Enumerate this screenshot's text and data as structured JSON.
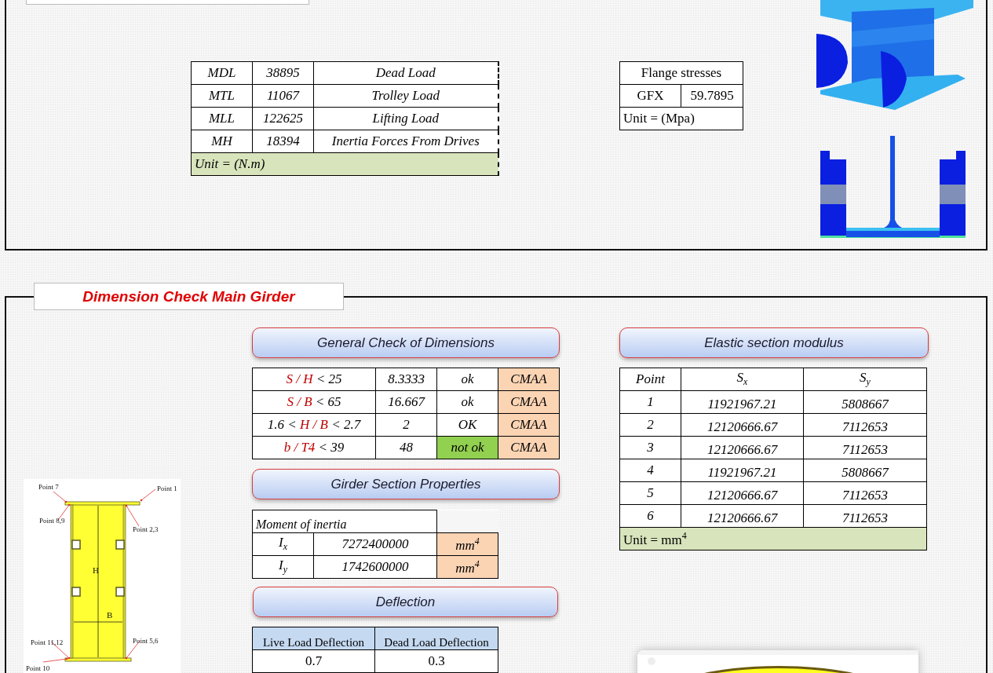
{
  "moments": {
    "rows": [
      {
        "symbol": "MDL",
        "value": "38895",
        "description": "Dead Load"
      },
      {
        "symbol": "MTL",
        "value": "11067",
        "description": "Trolley Load"
      },
      {
        "symbol": "MLL",
        "value": "122625",
        "description": "Lifting Load"
      },
      {
        "symbol": "MH",
        "value": "18394",
        "description": "Inertia Forces From Drives"
      }
    ],
    "unit": "Unit = (N.m)"
  },
  "flange_stresses": {
    "title": "Flange stresses",
    "label": "GFX",
    "value": "59.7895",
    "unit": "Unit = (Mpa)"
  },
  "section_title": "Dimension Check Main Girder",
  "general_check": {
    "title": "General Check of Dimensions",
    "rows": [
      {
        "prefix": "",
        "ratio": "S / H",
        "suffix": "< 25",
        "value": "8.3333",
        "result": "ok",
        "highlighted": false,
        "code": "CMAA"
      },
      {
        "prefix": "",
        "ratio": "S / B",
        "suffix": "< 65",
        "value": "16.667",
        "result": "ok",
        "highlighted": false,
        "code": "CMAA"
      },
      {
        "prefix": "1.6 <",
        "ratio": "H / B",
        "suffix": "< 2.7",
        "value": "2",
        "result": "OK",
        "highlighted": false,
        "code": "CMAA"
      },
      {
        "prefix": "",
        "ratio": "b / T4",
        "suffix": "< 39",
        "value": "48",
        "result": "not ok",
        "highlighted": true,
        "code": "CMAA"
      }
    ]
  },
  "section_properties": {
    "title": "Girder Section Properties",
    "header": "Moment of inertia",
    "rows": [
      {
        "symbol": "I$_{x}$",
        "value": "7272400000",
        "unit": "mm$^{4}$"
      },
      {
        "symbol": "I$_{y}$",
        "value": "1742600000",
        "unit": "mm$^{4}$"
      }
    ]
  },
  "deflection": {
    "title": "Deflection",
    "columns": [
      "Live Load Deflection",
      "Dead Load Deflection"
    ],
    "values": [
      "0.7",
      "0.3"
    ]
  },
  "elastic_section_modulus": {
    "title": "Elastic section modulus",
    "columns": [
      "Point",
      "S$_{x}$",
      "S$_{y}$"
    ],
    "rows": [
      {
        "point": "1",
        "sx": "11921967.21",
        "sy": "5808667"
      },
      {
        "point": "2",
        "sx": "12120666.67",
        "sy": "7112653"
      },
      {
        "point": "3",
        "sx": "12120666.67",
        "sy": "7112653"
      },
      {
        "point": "4",
        "sx": "11921967.21",
        "sy": "5808667"
      },
      {
        "point": "5",
        "sx": "12120666.67",
        "sy": "7112653"
      },
      {
        "point": "6",
        "sx": "12120666.67",
        "sy": "7112653"
      }
    ],
    "unit": "Unit = mm$^{4}$"
  },
  "girder_diagram": {
    "labels": [
      "Point 7",
      "Point 1",
      "Point 8,9",
      "Point 2,3",
      "H",
      "B",
      "Point 11,12",
      "Point 5,6",
      "Point 10"
    ]
  }
}
